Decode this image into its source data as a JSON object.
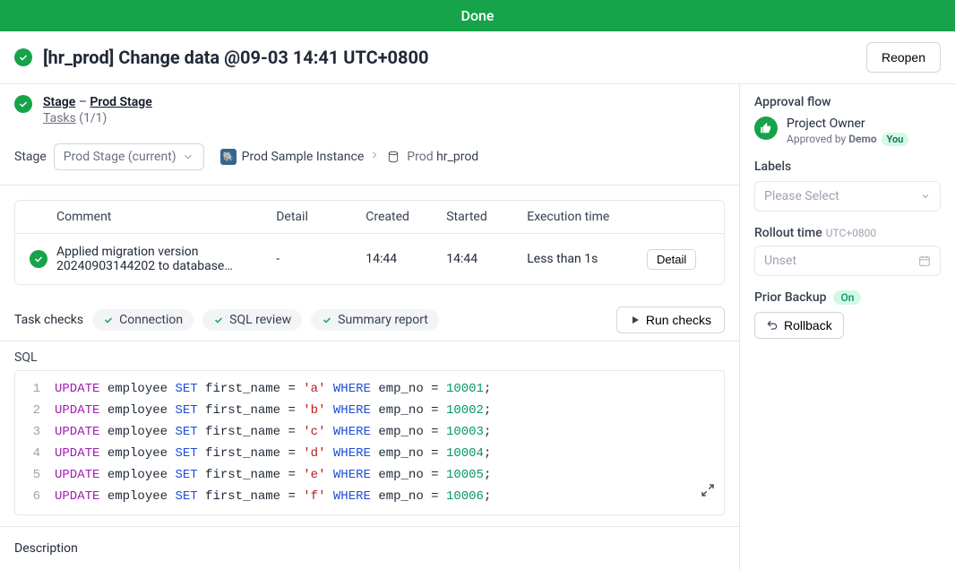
{
  "banner": {
    "status": "Done"
  },
  "header": {
    "title": "[hr_prod] Change data @09-03 14:41 UTC+0800",
    "reopen": "Reopen"
  },
  "stage_block": {
    "stage_label": "Stage",
    "dash": " – ",
    "stage_name": "Prod Stage",
    "tasks_label": "Tasks",
    "tasks_count": "(1/1)"
  },
  "stage_row": {
    "label": "Stage",
    "selector": "Prod Stage (current)",
    "breadcrumb": {
      "instance": "Prod Sample Instance",
      "db_prefix": "Prod ",
      "db": "hr_prod"
    }
  },
  "table": {
    "headers": {
      "comment": "Comment",
      "detail": "Detail",
      "created": "Created",
      "started": "Started",
      "exec": "Execution time"
    },
    "row": {
      "comment": "Applied migration version 20240903144202 to database…",
      "detail_val": "-",
      "created": "14:44",
      "started": "14:44",
      "exec": "Less than 1s",
      "detail_btn": "Detail"
    }
  },
  "checks": {
    "label": "Task checks",
    "items": [
      "Connection",
      "SQL review",
      "Summary report"
    ],
    "run": "Run checks"
  },
  "sql": {
    "label": "SQL",
    "lines": [
      {
        "n": "1",
        "table": "employee",
        "col": "first_name",
        "val": "'a'",
        "where_col": "emp_no",
        "num": "10001"
      },
      {
        "n": "2",
        "table": "employee",
        "col": "first_name",
        "val": "'b'",
        "where_col": "emp_no",
        "num": "10002"
      },
      {
        "n": "3",
        "table": "employee",
        "col": "first_name",
        "val": "'c'",
        "where_col": "emp_no",
        "num": "10003"
      },
      {
        "n": "4",
        "table": "employee",
        "col": "first_name",
        "val": "'d'",
        "where_col": "emp_no",
        "num": "10004"
      },
      {
        "n": "5",
        "table": "employee",
        "col": "first_name",
        "val": "'e'",
        "where_col": "emp_no",
        "num": "10005"
      },
      {
        "n": "6",
        "table": "employee",
        "col": "first_name",
        "val": "'f'",
        "where_col": "emp_no",
        "num": "10006"
      }
    ],
    "kw": {
      "update": "UPDATE",
      "set": "SET",
      "where": "WHERE",
      "eq": " = ",
      "semi": ";"
    }
  },
  "description": {
    "label": "Description"
  },
  "sidebar": {
    "approval": {
      "heading": "Approval flow",
      "role": "Project Owner",
      "by": "Approved by ",
      "user": "Demo",
      "you": "You"
    },
    "labels": {
      "heading": "Labels",
      "placeholder": "Please Select"
    },
    "rollout": {
      "heading": "Rollout time",
      "tz": "UTC+0800",
      "placeholder": "Unset"
    },
    "prior": {
      "heading": "Prior Backup",
      "badge": "On",
      "rollback": "Rollback"
    }
  }
}
